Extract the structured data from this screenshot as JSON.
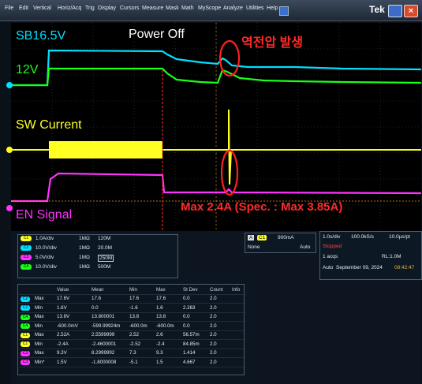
{
  "menubar": {
    "items": [
      "File",
      "Edit",
      "Vertical",
      "Horiz/Acq",
      "Trig",
      "Display",
      "Cursors",
      "Measure",
      "Mask",
      "Math",
      "MyScope",
      "Analyze",
      "Utilities",
      "Help"
    ],
    "brand": "Tek"
  },
  "annotations": {
    "sb": "SB16.5V",
    "v12": "12V",
    "sw": "SW Current",
    "en": "EN Signal",
    "power_off": "Power Off",
    "korean": "역전압 발생",
    "max_current": "Max 2.4A (Spec. : Max 3.85A)"
  },
  "colors": {
    "ch1": "#ffff22",
    "ch2": "#00e0ff",
    "ch3": "#ff33ff",
    "ch4": "#18ff18",
    "annotation": "#ff2a2a"
  },
  "channels": [
    {
      "id": "C1",
      "scale": "1.0A/div",
      "impedance": "1MΩ",
      "bw": "120M"
    },
    {
      "id": "C2",
      "scale": "10.0V/div",
      "impedance": "1MΩ",
      "bw": "20.0M"
    },
    {
      "id": "C3",
      "scale": "5.0V/div",
      "impedance": "1MΩ",
      "bw": "250M"
    },
    {
      "id": "C4",
      "scale": "10.0V/div",
      "impedance": "1MΩ",
      "bw": "500M"
    }
  ],
  "trigger": {
    "source": "C1",
    "level": "900mA",
    "coupling": "None",
    "mode": "Auto",
    "label": "A"
  },
  "acquisition": {
    "horizontal": "1.0s/div",
    "sample_rate": "100.0kS/s",
    "resolution": "10.0µs/pt",
    "state": "Stopped",
    "acqs": "1 acqs",
    "record_length": "RL:1.0M",
    "mode": "Auto",
    "date": "September 09, 2024",
    "time": "08:42:47"
  },
  "measurements": {
    "headers": [
      "",
      "",
      "Value",
      "Mean",
      "Min",
      "Max",
      "St Dev",
      "Count",
      "Info"
    ],
    "rows": [
      {
        "ch": "C2",
        "type": "Max",
        "value": "17.6V",
        "mean": "17.6",
        "min": "17.6",
        "max": "17.6",
        "stdev": "0.0",
        "count": "2.0",
        "info": ""
      },
      {
        "ch": "C2",
        "type": "Min",
        "value": "1.6V",
        "mean": "0.0",
        "min": "-1.6",
        "max": "1.6",
        "stdev": "2.263",
        "count": "2.0",
        "info": ""
      },
      {
        "ch": "C4",
        "type": "Max",
        "value": "13.8V",
        "mean": "13.800001",
        "min": "13.8",
        "max": "13.8",
        "stdev": "0.0",
        "count": "2.0",
        "info": ""
      },
      {
        "ch": "C4",
        "type": "Min",
        "value": "-600.0mV",
        "mean": "-599.99924m",
        "min": "-600.0m",
        "max": "-600.0m",
        "stdev": "0.0",
        "count": "2.0",
        "info": ""
      },
      {
        "ch": "C1",
        "type": "Max",
        "value": "2.52A",
        "mean": "2.5599999",
        "min": "2.52",
        "max": "2.6",
        "stdev": "56.57m",
        "count": "2.0",
        "info": ""
      },
      {
        "ch": "C1",
        "type": "Min",
        "value": "-2.4A",
        "mean": "-2.4600001",
        "min": "-2.52",
        "max": "-2.4",
        "stdev": "84.85m",
        "count": "2.0",
        "info": ""
      },
      {
        "ch": "C3",
        "type": "Max",
        "value": "9.3V",
        "mean": "8.2999992",
        "min": "7.3",
        "max": "9.3",
        "stdev": "1.414",
        "count": "2.0",
        "info": ""
      },
      {
        "ch": "C3",
        "type": "Min*",
        "value": "1.5V",
        "mean": "-1.8000008",
        "min": "-5.1",
        "max": "1.5",
        "stdev": "4.667",
        "count": "2.0",
        "info": ""
      }
    ]
  }
}
